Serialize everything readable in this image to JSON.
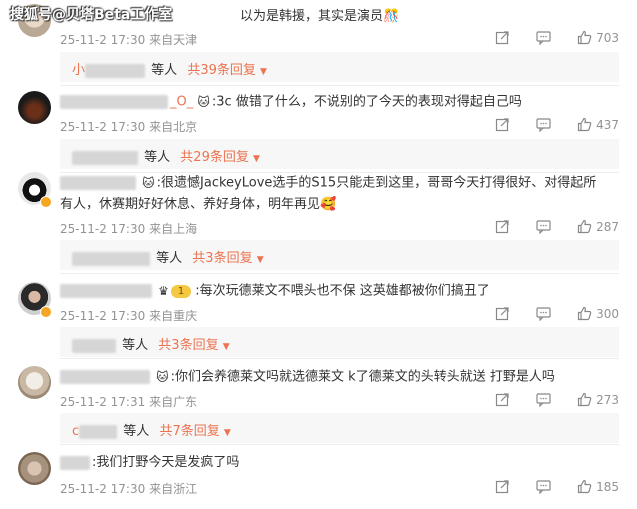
{
  "watermark": "搜狐号@贝塔Beta工作室",
  "comments": [
    {
      "text": "以为是韩援，其实是演员",
      "emoji": "🎊",
      "time": "25-11-2 17:30",
      "location": "来自天津",
      "likes": "703",
      "replies": {
        "prefix": "小",
        "who": "等人",
        "count": "共39条回复"
      }
    },
    {
      "name_tail": "_O_",
      "text": ":3c 做错了什么，不说别的了今天的表现对得起自己吗",
      "time": "25-11-2 17:30",
      "location": "来自北京",
      "likes": "437",
      "replies": {
        "prefix": "",
        "who": "等人",
        "count": "共29条回复"
      }
    },
    {
      "text": ":很遗憾JackeyLove选手的S15只能走到这里，哥哥今天打得很好、对得起所",
      "text2": "有人，休赛期好好休息、养好身体，明年再见",
      "emoji": "🥰",
      "time": "25-11-2 17:30",
      "location": "来自上海",
      "likes": "287",
      "replies": {
        "prefix": "",
        "who": "等人",
        "count": "共3条回复"
      }
    },
    {
      "text": ":每次玩德莱文不喂头也不保 这英雄都被你们搞丑了",
      "level": "1",
      "time": "25-11-2 17:30",
      "location": "来自重庆",
      "likes": "300",
      "replies": {
        "prefix": "",
        "who": "等人",
        "count": "共3条回复"
      }
    },
    {
      "text": ":你们会养德莱文吗就选德莱文  k了德莱文的头转头就送 打野是人吗",
      "time": "25-11-2 17:31",
      "location": "来自广东",
      "likes": "273",
      "replies": {
        "prefix": "c",
        "who": "等人",
        "count": "共7条回复"
      }
    },
    {
      "text": ":我们打野今天是发疯了吗",
      "time": "25-11-2 17:30",
      "location": "来自浙江",
      "likes": "185"
    }
  ],
  "colors": {
    "accent": "#eb7350",
    "meta": "#939393",
    "replyBg": "#f7f7f7"
  },
  "icons": [
    "share-icon",
    "comment-icon",
    "like-icon",
    "chevron-down-icon",
    "crown-badge-icon"
  ]
}
